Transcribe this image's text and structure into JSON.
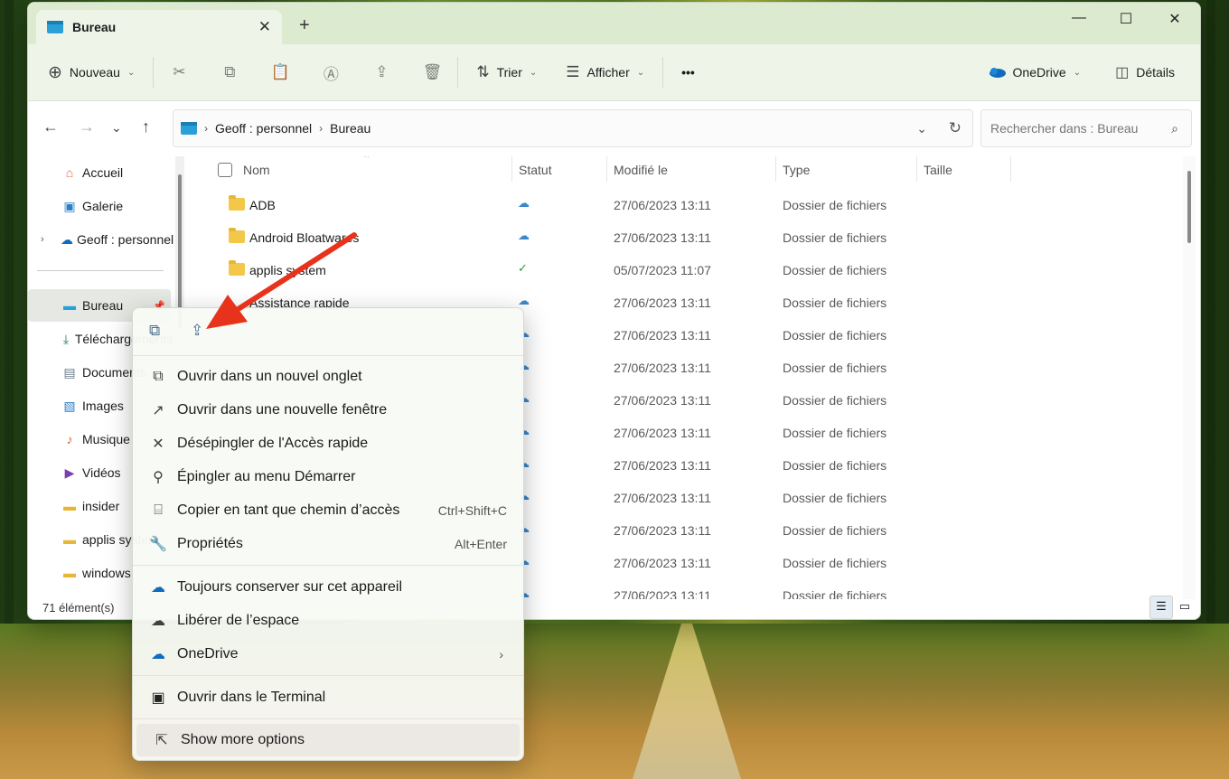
{
  "window": {
    "tab_title": "Bureau",
    "close_tab": "✕",
    "new_tab": "+",
    "minimize": "—",
    "maximize": "☐",
    "close": "✕"
  },
  "toolbar": {
    "new_label": "Nouveau",
    "sort_label": "Trier",
    "view_label": "Afficher",
    "more_label": "•••",
    "onedrive_label": "OneDrive",
    "details_label": "Détails"
  },
  "address": {
    "crumb_1": "Geoff : personnel",
    "crumb_2": "Bureau",
    "search_placeholder": "Rechercher dans : Bureau"
  },
  "sidebar": {
    "items": [
      {
        "label": "Accueil",
        "icon": "home-icon"
      },
      {
        "label": "Galerie",
        "icon": "gallery-icon"
      },
      {
        "label": "Geoff : personnel",
        "icon": "onedrive-icon"
      },
      {
        "label": "Bureau",
        "icon": "desktop-icon"
      },
      {
        "label": "Téléchargements",
        "icon": "download-icon"
      },
      {
        "label": "Documents",
        "icon": "document-icon"
      },
      {
        "label": "Images",
        "icon": "image-icon"
      },
      {
        "label": "Musique",
        "icon": "music-icon"
      },
      {
        "label": "Vidéos",
        "icon": "video-icon"
      },
      {
        "label": "insider",
        "icon": "folder-icon"
      },
      {
        "label": "applis system",
        "icon": "folder-icon"
      },
      {
        "label": "windows",
        "icon": "folder-icon"
      }
    ]
  },
  "columns": {
    "name": "Nom",
    "status": "Statut",
    "modified": "Modifié le",
    "type": "Type",
    "size": "Taille"
  },
  "files": [
    {
      "name": "ADB",
      "status": "cloud",
      "date": "27/06/2023 13:11",
      "type": "Dossier de fichiers"
    },
    {
      "name": "Android Bloatwares",
      "status": "cloud",
      "date": "27/06/2023 13:11",
      "type": "Dossier de fichiers"
    },
    {
      "name": "applis system",
      "status": "synced",
      "date": "05/07/2023 11:07",
      "type": "Dossier de fichiers"
    },
    {
      "name": "Assistance rapide",
      "status": "cloud",
      "date": "27/06/2023 13:11",
      "type": "Dossier de fichiers"
    },
    {
      "name": "",
      "status": "cloud",
      "date": "27/06/2023 13:11",
      "type": "Dossier de fichiers"
    },
    {
      "name": "",
      "status": "cloud",
      "date": "27/06/2023 13:11",
      "type": "Dossier de fichiers"
    },
    {
      "name": "",
      "status": "cloud",
      "date": "27/06/2023 13:11",
      "type": "Dossier de fichiers"
    },
    {
      "name": "",
      "status": "cloud",
      "date": "27/06/2023 13:11",
      "type": "Dossier de fichiers"
    },
    {
      "name": "",
      "status": "cloud",
      "date": "27/06/2023 13:11",
      "type": "Dossier de fichiers"
    },
    {
      "name": "",
      "status": "cloud",
      "date": "27/06/2023 13:11",
      "type": "Dossier de fichiers"
    },
    {
      "name": "",
      "status": "cloud",
      "date": "27/06/2023 13:11",
      "type": "Dossier de fichiers"
    },
    {
      "name": "",
      "status": "cloud",
      "date": "27/06/2023 13:11",
      "type": "Dossier de fichiers"
    },
    {
      "name": "",
      "status": "cloud",
      "date": "27/06/2023 13:11",
      "type": "Dossier de fichiers"
    }
  ],
  "status_bar": {
    "count": "71 élément(s)"
  },
  "context_menu": {
    "items": [
      {
        "label": "Ouvrir dans un nouvel onglet",
        "icon": "open-tab-icon",
        "shortcut": ""
      },
      {
        "label": "Ouvrir dans une nouvelle fenêtre",
        "icon": "open-window-icon",
        "shortcut": ""
      },
      {
        "label": "Désépingler de l'Accès rapide",
        "icon": "unpin-icon",
        "shortcut": ""
      },
      {
        "label": "Épingler au menu Démarrer",
        "icon": "pin-icon",
        "shortcut": ""
      },
      {
        "label": "Copier en tant que chemin d’accès",
        "icon": "copy-path-icon",
        "shortcut": "Ctrl+Shift+C"
      },
      {
        "label": "Propriétés",
        "icon": "properties-icon",
        "shortcut": "Alt+Enter"
      },
      {
        "label": "Toujours conserver sur cet appareil",
        "icon": "keep-device-icon",
        "shortcut": ""
      },
      {
        "label": "Libérer de l’espace",
        "icon": "free-space-icon",
        "shortcut": ""
      },
      {
        "label": "OneDrive",
        "icon": "onedrive-icon",
        "shortcut": ""
      },
      {
        "label": "Ouvrir dans le Terminal",
        "icon": "terminal-icon",
        "shortcut": ""
      },
      {
        "label": "Show more options",
        "icon": "more-options-icon",
        "shortcut": ""
      }
    ]
  },
  "colors": {
    "accent": "#0f6cbd",
    "annotation_arrow": "#e8331c",
    "titlebar": "#dcebcf"
  }
}
